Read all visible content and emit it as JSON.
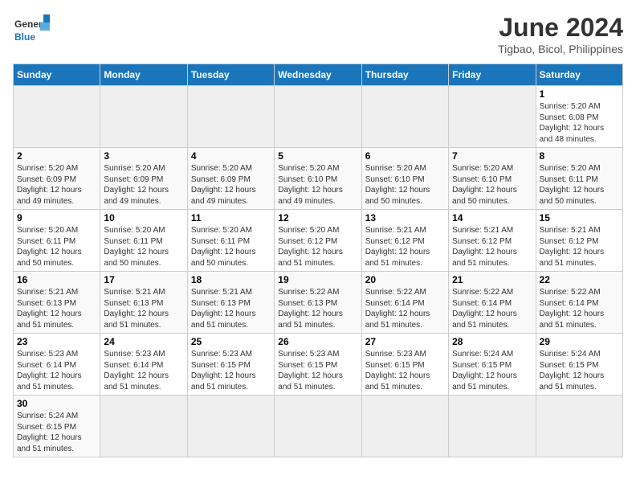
{
  "logo": {
    "text_general": "General",
    "text_blue": "Blue"
  },
  "title": "June 2024",
  "subtitle": "Tigbao, Bicol, Philippines",
  "days_of_week": [
    "Sunday",
    "Monday",
    "Tuesday",
    "Wednesday",
    "Thursday",
    "Friday",
    "Saturday"
  ],
  "weeks": [
    [
      {
        "day": "",
        "info": "",
        "empty": true
      },
      {
        "day": "",
        "info": "",
        "empty": true
      },
      {
        "day": "",
        "info": "",
        "empty": true
      },
      {
        "day": "",
        "info": "",
        "empty": true
      },
      {
        "day": "",
        "info": "",
        "empty": true
      },
      {
        "day": "",
        "info": "",
        "empty": true
      },
      {
        "day": "1",
        "info": "Sunrise: 5:20 AM\nSunset: 6:08 PM\nDaylight: 12 hours and 48 minutes."
      }
    ],
    [
      {
        "day": "2",
        "info": "Sunrise: 5:20 AM\nSunset: 6:09 PM\nDaylight: 12 hours and 49 minutes."
      },
      {
        "day": "3",
        "info": "Sunrise: 5:20 AM\nSunset: 6:09 PM\nDaylight: 12 hours and 49 minutes."
      },
      {
        "day": "4",
        "info": "Sunrise: 5:20 AM\nSunset: 6:09 PM\nDaylight: 12 hours and 49 minutes."
      },
      {
        "day": "5",
        "info": "Sunrise: 5:20 AM\nSunset: 6:10 PM\nDaylight: 12 hours and 49 minutes."
      },
      {
        "day": "6",
        "info": "Sunrise: 5:20 AM\nSunset: 6:10 PM\nDaylight: 12 hours and 50 minutes."
      },
      {
        "day": "7",
        "info": "Sunrise: 5:20 AM\nSunset: 6:10 PM\nDaylight: 12 hours and 50 minutes."
      },
      {
        "day": "8",
        "info": "Sunrise: 5:20 AM\nSunset: 6:11 PM\nDaylight: 12 hours and 50 minutes."
      }
    ],
    [
      {
        "day": "9",
        "info": "Sunrise: 5:20 AM\nSunset: 6:11 PM\nDaylight: 12 hours and 50 minutes."
      },
      {
        "day": "10",
        "info": "Sunrise: 5:20 AM\nSunset: 6:11 PM\nDaylight: 12 hours and 50 minutes."
      },
      {
        "day": "11",
        "info": "Sunrise: 5:20 AM\nSunset: 6:11 PM\nDaylight: 12 hours and 50 minutes."
      },
      {
        "day": "12",
        "info": "Sunrise: 5:20 AM\nSunset: 6:12 PM\nDaylight: 12 hours and 51 minutes."
      },
      {
        "day": "13",
        "info": "Sunrise: 5:21 AM\nSunset: 6:12 PM\nDaylight: 12 hours and 51 minutes."
      },
      {
        "day": "14",
        "info": "Sunrise: 5:21 AM\nSunset: 6:12 PM\nDaylight: 12 hours and 51 minutes."
      },
      {
        "day": "15",
        "info": "Sunrise: 5:21 AM\nSunset: 6:12 PM\nDaylight: 12 hours and 51 minutes."
      }
    ],
    [
      {
        "day": "16",
        "info": "Sunrise: 5:21 AM\nSunset: 6:13 PM\nDaylight: 12 hours and 51 minutes."
      },
      {
        "day": "17",
        "info": "Sunrise: 5:21 AM\nSunset: 6:13 PM\nDaylight: 12 hours and 51 minutes."
      },
      {
        "day": "18",
        "info": "Sunrise: 5:21 AM\nSunset: 6:13 PM\nDaylight: 12 hours and 51 minutes."
      },
      {
        "day": "19",
        "info": "Sunrise: 5:22 AM\nSunset: 6:13 PM\nDaylight: 12 hours and 51 minutes."
      },
      {
        "day": "20",
        "info": "Sunrise: 5:22 AM\nSunset: 6:14 PM\nDaylight: 12 hours and 51 minutes."
      },
      {
        "day": "21",
        "info": "Sunrise: 5:22 AM\nSunset: 6:14 PM\nDaylight: 12 hours and 51 minutes."
      },
      {
        "day": "22",
        "info": "Sunrise: 5:22 AM\nSunset: 6:14 PM\nDaylight: 12 hours and 51 minutes."
      }
    ],
    [
      {
        "day": "23",
        "info": "Sunrise: 5:23 AM\nSunset: 6:14 PM\nDaylight: 12 hours and 51 minutes."
      },
      {
        "day": "24",
        "info": "Sunrise: 5:23 AM\nSunset: 6:14 PM\nDaylight: 12 hours and 51 minutes."
      },
      {
        "day": "25",
        "info": "Sunrise: 5:23 AM\nSunset: 6:15 PM\nDaylight: 12 hours and 51 minutes."
      },
      {
        "day": "26",
        "info": "Sunrise: 5:23 AM\nSunset: 6:15 PM\nDaylight: 12 hours and 51 minutes."
      },
      {
        "day": "27",
        "info": "Sunrise: 5:23 AM\nSunset: 6:15 PM\nDaylight: 12 hours and 51 minutes."
      },
      {
        "day": "28",
        "info": "Sunrise: 5:24 AM\nSunset: 6:15 PM\nDaylight: 12 hours and 51 minutes."
      },
      {
        "day": "29",
        "info": "Sunrise: 5:24 AM\nSunset: 6:15 PM\nDaylight: 12 hours and 51 minutes."
      }
    ],
    [
      {
        "day": "30",
        "info": "Sunrise: 5:24 AM\nSunset: 6:15 PM\nDaylight: 12 hours and 51 minutes."
      },
      {
        "day": "",
        "info": "",
        "empty": true
      },
      {
        "day": "",
        "info": "",
        "empty": true
      },
      {
        "day": "",
        "info": "",
        "empty": true
      },
      {
        "day": "",
        "info": "",
        "empty": true
      },
      {
        "day": "",
        "info": "",
        "empty": true
      },
      {
        "day": "",
        "info": "",
        "empty": true
      }
    ]
  ]
}
